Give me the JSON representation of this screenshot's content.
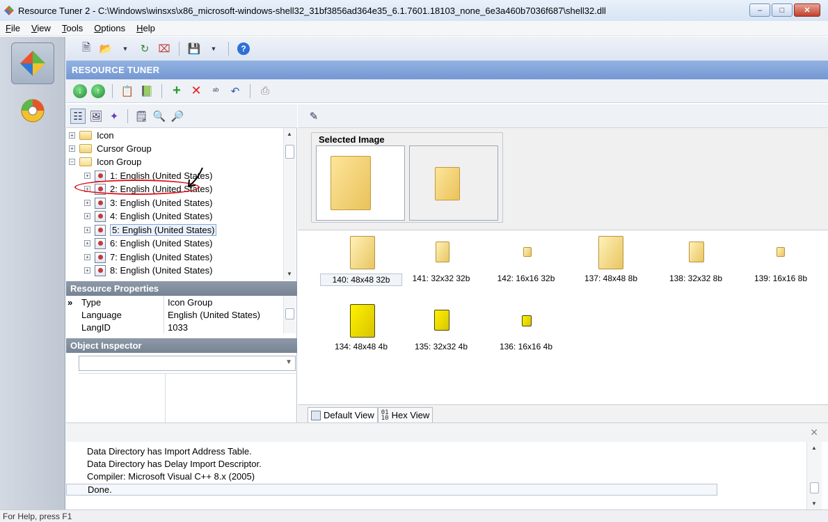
{
  "window": {
    "title": "Resource Tuner 2 - C:\\Windows\\winsxs\\x86_microsoft-windows-shell32_31bf3856ad364e35_6.1.7601.18103_none_6e3a460b7036f687\\shell32.dll",
    "controls": [
      "minimize",
      "maximize",
      "close"
    ]
  },
  "menu": [
    "File",
    "View",
    "Tools",
    "Options",
    "Help"
  ],
  "banner": "RESOURCE TUNER",
  "tree": {
    "items": [
      {
        "label": "Icon",
        "type": "folder"
      },
      {
        "label": "Cursor Group",
        "type": "folder"
      },
      {
        "label": "Icon Group",
        "type": "folder-open"
      },
      {
        "label": "1: English (United States)",
        "type": "resource"
      },
      {
        "label": "2: English (United States)",
        "type": "resource"
      },
      {
        "label": "3: English (United States)",
        "type": "resource"
      },
      {
        "label": "4: English (United States)",
        "type": "resource"
      },
      {
        "label": "5: English (United States)",
        "type": "resource",
        "selected": true
      },
      {
        "label": "6: English (United States)",
        "type": "resource"
      },
      {
        "label": "7: English (United States)",
        "type": "resource"
      },
      {
        "label": "8: English (United States)",
        "type": "resource"
      }
    ]
  },
  "properties": {
    "header": "Resource Properties",
    "marker": "»",
    "rows": [
      {
        "name": "Type",
        "value": "Icon Group"
      },
      {
        "name": "Language",
        "value": "English (United States)"
      },
      {
        "name": "LangID",
        "value": "1033"
      }
    ]
  },
  "inspector": {
    "header": "Object Inspector"
  },
  "selected_image": {
    "label": "Selected Image"
  },
  "gallery": [
    {
      "label": "140: 48x48 32b",
      "selected": true
    },
    {
      "label": "141: 32x32 32b"
    },
    {
      "label": "142: 16x16 32b"
    },
    {
      "label": "137: 48x48 8b"
    },
    {
      "label": "138: 32x32 8b"
    },
    {
      "label": "139: 16x16 8b"
    },
    {
      "label": "134: 48x48 4b"
    },
    {
      "label": "135: 32x32 4b"
    },
    {
      "label": "136: 16x16 4b"
    }
  ],
  "view_tabs": [
    {
      "label": "Default View",
      "active": true
    },
    {
      "label": "Hex View"
    }
  ],
  "log": {
    "lines": [
      "Data Directory has Import Address Table.",
      "Data Directory has Delay Import Descriptor.",
      "Compiler: Microsoft Visual C++ 8.x (2005)",
      "Done."
    ]
  },
  "status": "For Help, press F1",
  "colors": {
    "annotation": "#e0131b",
    "banner": "#7a9ad4"
  }
}
